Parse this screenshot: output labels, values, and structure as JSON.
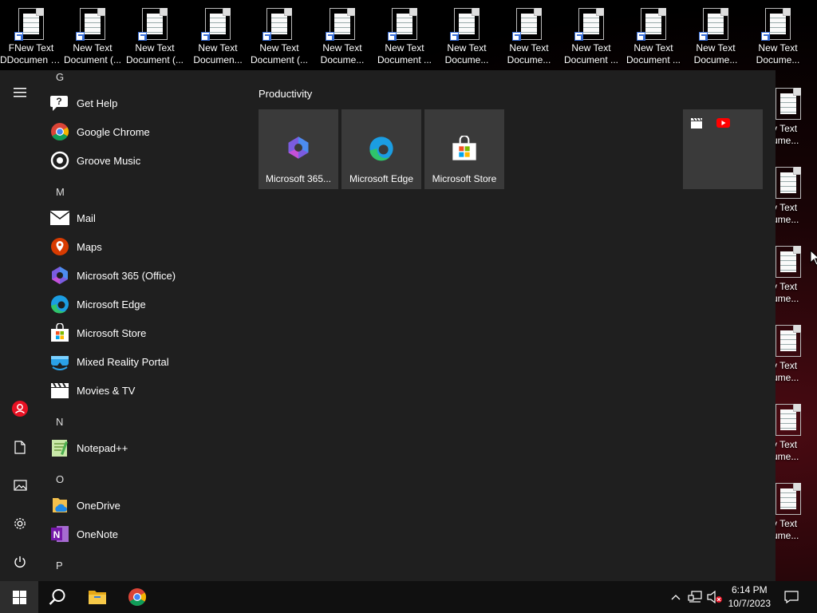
{
  "desktop": {
    "top_icons": [
      {
        "label1": "FNew Text",
        "label2": "DDocumen (2)"
      },
      {
        "label1": "New Text",
        "label2": "Document (..."
      },
      {
        "label1": "New Text",
        "label2": "Document (..."
      },
      {
        "label1": "New Text",
        "label2": "Documen..."
      },
      {
        "label1": "New Text",
        "label2": "Document (..."
      },
      {
        "label1": "New Text",
        "label2": "Docume..."
      },
      {
        "label1": "New Text",
        "label2": "Document ..."
      },
      {
        "label1": "New Text",
        "label2": "Docume..."
      },
      {
        "label1": "New Text",
        "label2": "Docume..."
      },
      {
        "label1": "New Text",
        "label2": "Document ..."
      },
      {
        "label1": "New Text",
        "label2": "Document ..."
      },
      {
        "label1": "New Text",
        "label2": "Docume..."
      },
      {
        "label1": "New Text",
        "label2": "Docume..."
      }
    ],
    "right_icons": [
      {
        "label1": "v Text",
        "label2": "ume..."
      },
      {
        "label1": "v Text",
        "label2": "ume..."
      },
      {
        "label1": "v Text",
        "label2": "ume..."
      },
      {
        "label1": "v Text",
        "label2": "ume..."
      },
      {
        "label1": "v Text",
        "label2": "ume..."
      },
      {
        "label1": "v Text",
        "label2": "ume..."
      }
    ]
  },
  "start_menu": {
    "letters": {
      "g": "G",
      "m": "M",
      "n": "N",
      "o": "O",
      "p": "P"
    },
    "apps": {
      "get_help": "Get Help",
      "chrome": "Google Chrome",
      "groove": "Groove Music",
      "mail": "Mail",
      "maps": "Maps",
      "m365": "Microsoft 365 (Office)",
      "edge": "Microsoft Edge",
      "store": "Microsoft Store",
      "mixed_reality": "Mixed Reality Portal",
      "movies": "Movies & TV",
      "notepadpp": "Notepad++",
      "onedrive": "OneDrive",
      "onenote": "OneNote"
    },
    "group_title": "Productivity",
    "tiles": {
      "m365": "Microsoft 365...",
      "edge": "Microsoft Edge",
      "store": "Microsoft Store"
    }
  },
  "taskbar": {
    "time": "6:14 PM",
    "date": "10/7/2023"
  }
}
